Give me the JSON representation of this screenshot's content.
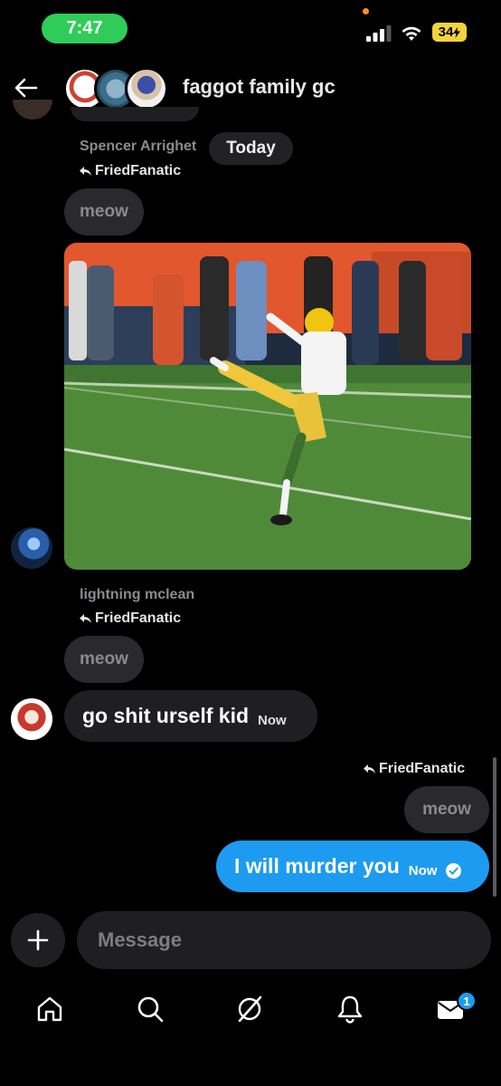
{
  "status_bar": {
    "time": "7:47",
    "battery": "34"
  },
  "header": {
    "title": "faggot family gc"
  },
  "date_divider": "Today",
  "messages": {
    "m1": {
      "sender": "Spencer Arrighet",
      "reply_to": "FriedFanatic",
      "quoted": "meow"
    },
    "m2": {
      "sender": "lightning mclean",
      "reply_to": "FriedFanatic",
      "quoted": "meow",
      "text": "go shit urself kid",
      "time": "Now"
    },
    "m3": {
      "reply_to": "FriedFanatic",
      "quoted": "meow",
      "text": "I will murder you",
      "time": "Now"
    }
  },
  "composer": {
    "placeholder": "Message"
  },
  "nav": {
    "messages_badge": "1"
  },
  "colors": {
    "accent": "#1d9bf0",
    "bubble": "#1f1f22",
    "time_pill": "#2fcc59",
    "battery": "#f3d43b"
  }
}
